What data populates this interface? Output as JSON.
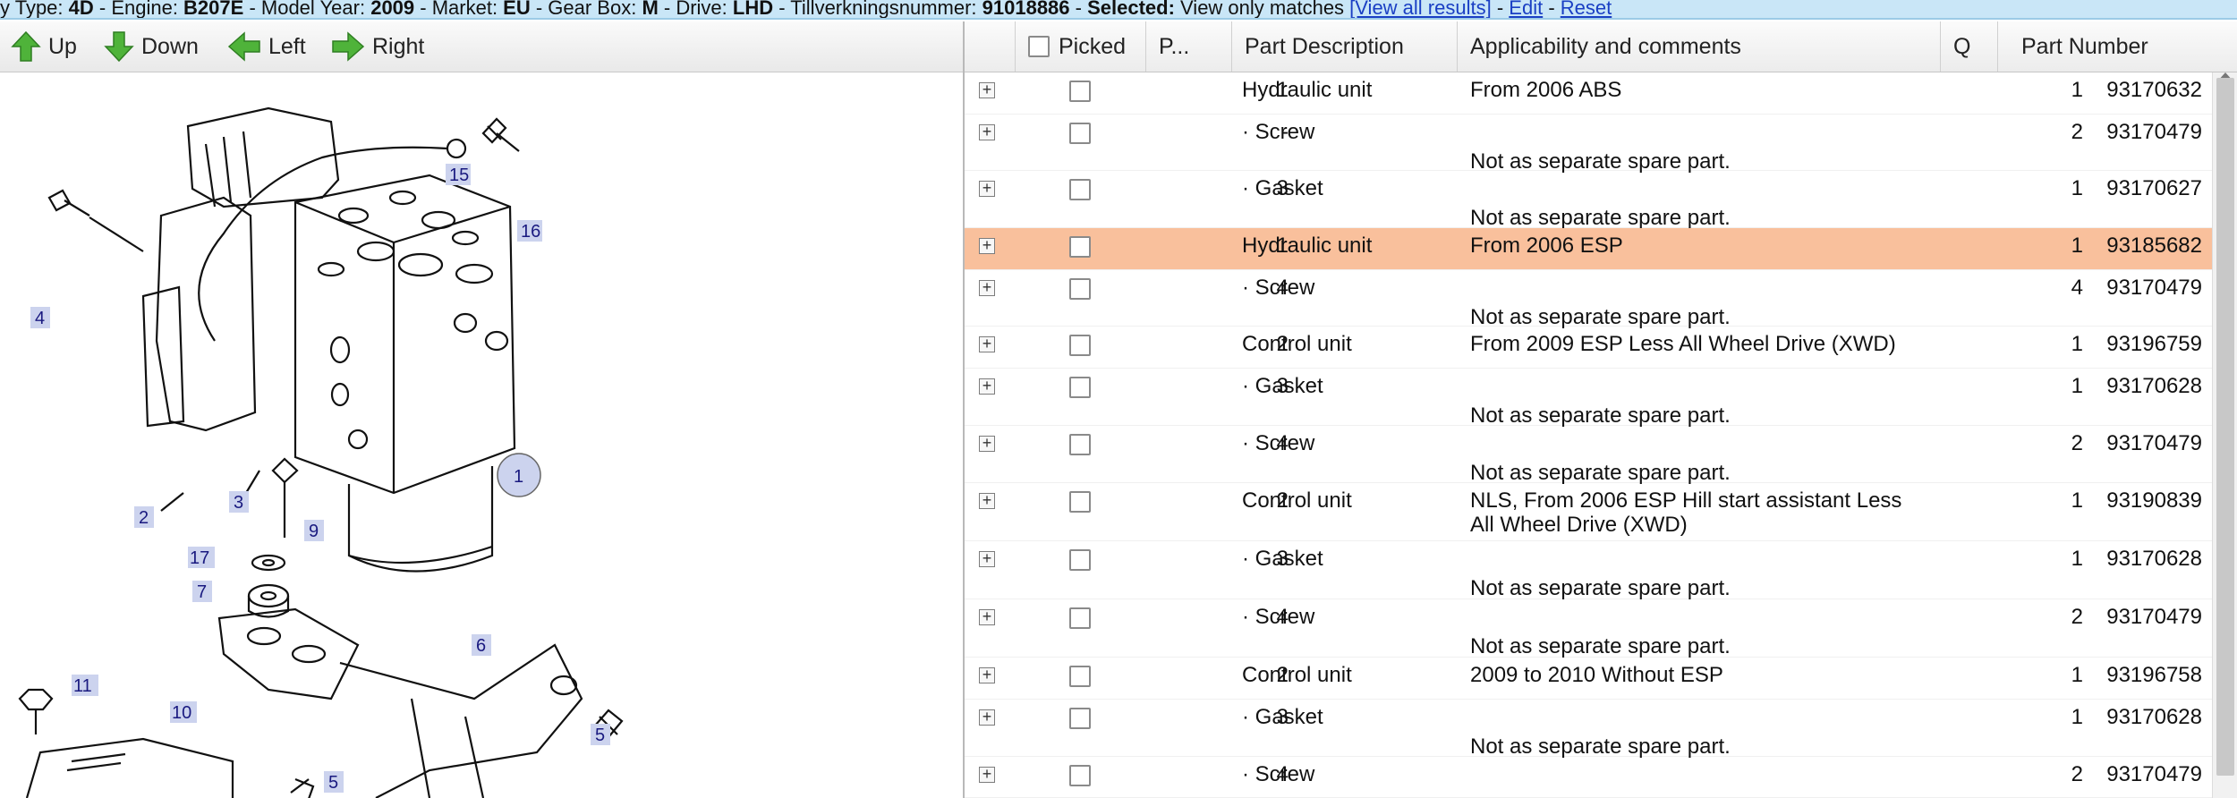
{
  "infobar": {
    "t1": "y Type: ",
    "v1": "4D",
    "t2": " - Engine: ",
    "v2": "B207E",
    "t3": " - Model Year: ",
    "v3": "2009",
    "t4": " - Market: ",
    "v4": "EU",
    "t5": " - Gear Box: ",
    "v5": "M",
    "t6": " - Drive: ",
    "v6": "LHD",
    "t7": " - Tillverkningsnummer: ",
    "v7": "91018886",
    "t8": " - ",
    "v8": "Selected:",
    "t9": " View only matches ",
    "view_all": "[View all results]",
    "sep1": " - ",
    "edit": "Edit",
    "sep2": " - ",
    "reset": "Reset"
  },
  "toolbar": {
    "up": "Up",
    "down": "Down",
    "left": "Left",
    "right": "Right"
  },
  "diagram": {
    "callouts": [
      "15",
      "16",
      "4",
      "2",
      "3",
      "9",
      "1",
      "17",
      "7",
      "11",
      "10",
      "6",
      "5",
      "5"
    ]
  },
  "table": {
    "headers": {
      "picked": "Picked",
      "pos": "P...",
      "desc": "Part Description",
      "appl": "Applicability and comments",
      "qty": "Q",
      "pnum": "Part Number"
    },
    "rows": [
      {
        "pos": "1",
        "desc": "Hydraulic unit",
        "appl": "From 2006 ABS",
        "note": "",
        "qty": "1",
        "pnum": "93170632"
      },
      {
        "pos": "-",
        "desc": "· Screw",
        "appl": "",
        "note": "Not as separate spare part.",
        "qty": "2",
        "pnum": "93170479"
      },
      {
        "pos": "3",
        "desc": "· Gasket",
        "appl": "",
        "note": "Not as separate spare part.",
        "qty": "1",
        "pnum": "93170627"
      },
      {
        "pos": "1",
        "desc": "Hydraulic unit",
        "appl": "From 2006 ESP",
        "note": "",
        "qty": "1",
        "pnum": "93185682"
      },
      {
        "pos": "4",
        "desc": "· Screw",
        "appl": "",
        "note": "Not as separate spare part.",
        "qty": "4",
        "pnum": "93170479"
      },
      {
        "pos": "2",
        "desc": "Control unit",
        "appl": "From 2009 ESP Less All Wheel Drive (XWD)",
        "note": "",
        "qty": "1",
        "pnum": "93196759"
      },
      {
        "pos": "3",
        "desc": "· Gasket",
        "appl": "",
        "note": "Not as separate spare part.",
        "qty": "1",
        "pnum": "93170628"
      },
      {
        "pos": "4",
        "desc": "· Screw",
        "appl": "",
        "note": "Not as separate spare part.",
        "qty": "2",
        "pnum": "93170479"
      },
      {
        "pos": "2",
        "desc": "Control unit",
        "appl": "NLS, From 2006 ESP Hill start assistant Less",
        "note": "All Wheel Drive (XWD)",
        "qty": "1",
        "pnum": "93190839"
      },
      {
        "pos": "3",
        "desc": "· Gasket",
        "appl": "",
        "note": "Not as separate spare part.",
        "qty": "1",
        "pnum": "93170628"
      },
      {
        "pos": "4",
        "desc": "· Screw",
        "appl": "",
        "note": "Not as separate spare part.",
        "qty": "2",
        "pnum": "93170479"
      },
      {
        "pos": "2",
        "desc": "Control unit",
        "appl": "2009 to 2010 Without ESP",
        "note": "",
        "qty": "1",
        "pnum": "93196758"
      },
      {
        "pos": "3",
        "desc": "· Gasket",
        "appl": "",
        "note": "Not as separate spare part.",
        "qty": "1",
        "pnum": "93170628"
      },
      {
        "pos": "4",
        "desc": "· Screw",
        "appl": "",
        "note": "",
        "qty": "2",
        "pnum": "93170479"
      }
    ]
  },
  "colors": {
    "infobar_bg": "#c9e6f7",
    "highlight": "#f9c09c",
    "nav_arrow": "#4fb33a",
    "link": "#1a3fc4"
  }
}
